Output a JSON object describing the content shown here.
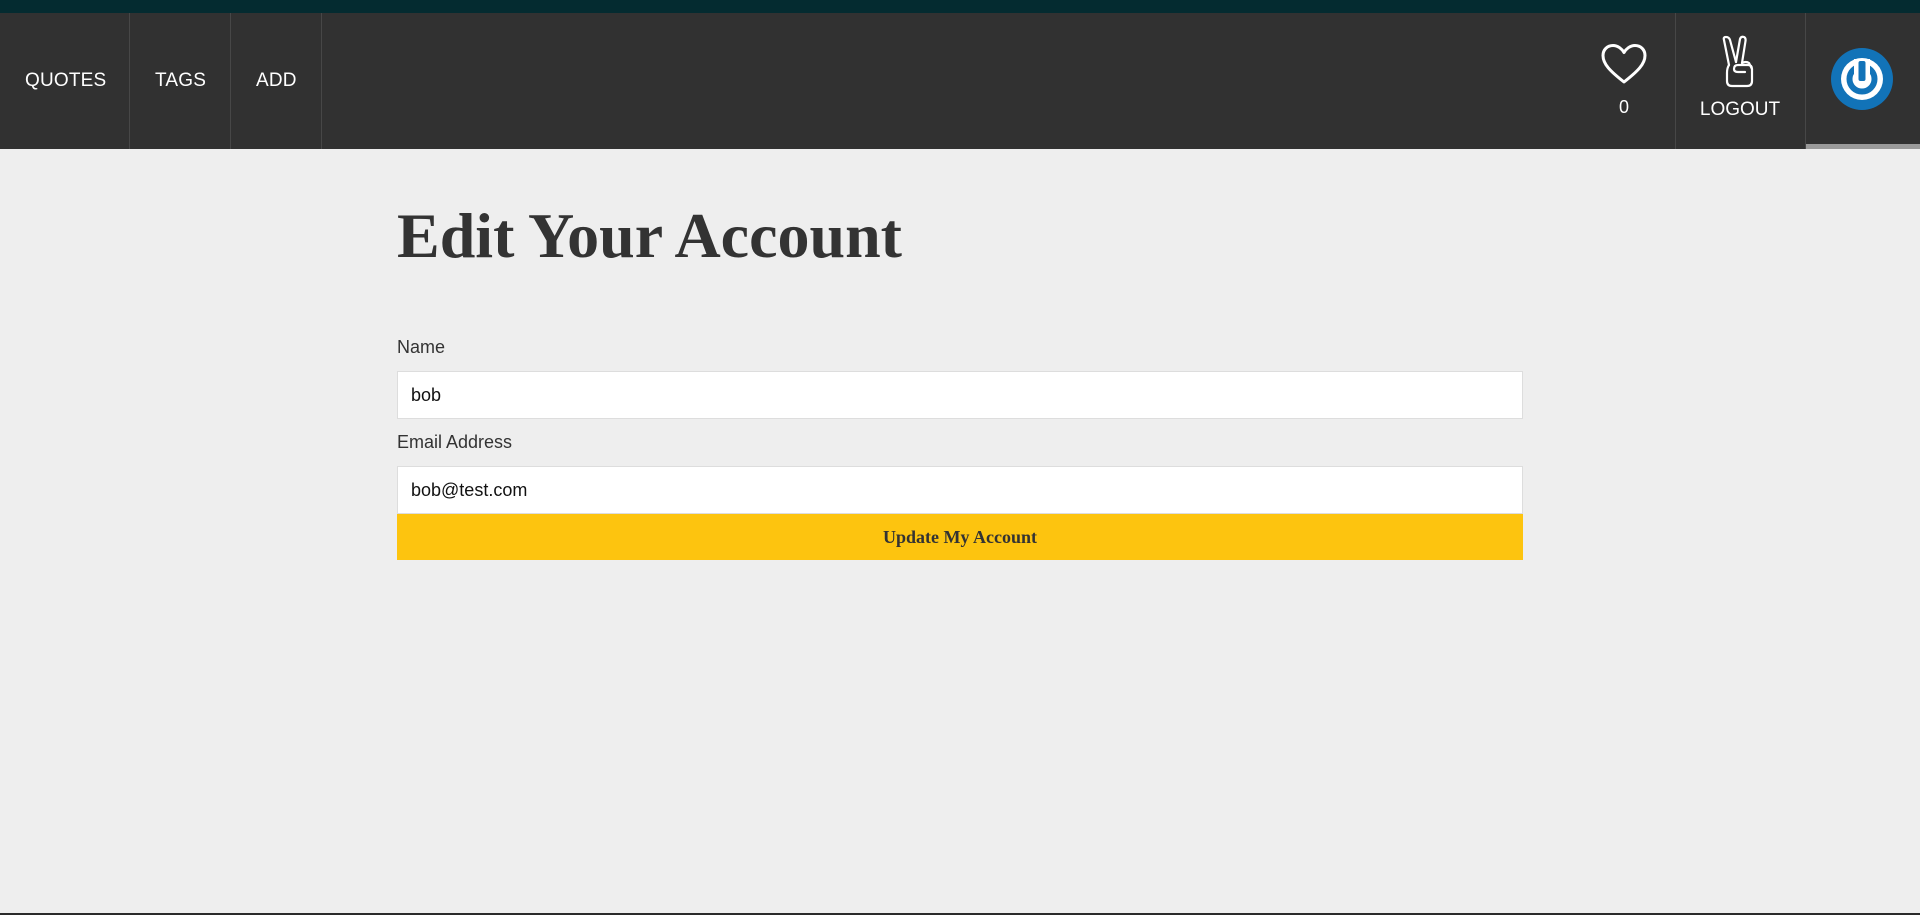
{
  "nav": {
    "links": [
      "QUOTES",
      "TAGS",
      "ADD"
    ],
    "favorites_count": "0",
    "logout_label": "LOGOUT"
  },
  "page": {
    "title": "Edit Your Account"
  },
  "form": {
    "name_label": "Name",
    "name_value": "bob",
    "email_label": "Email Address",
    "email_value": "bob@test.com",
    "submit_label": "Update My Account"
  },
  "icons": {
    "favorites": "heart-icon",
    "logout": "peace-hand-icon",
    "avatar": "power-icon"
  },
  "colors": {
    "topstrip": "#042b30",
    "navbar": "#313131",
    "background": "#eeeeee",
    "button": "#fdc40f",
    "avatar": "#1273b8"
  }
}
